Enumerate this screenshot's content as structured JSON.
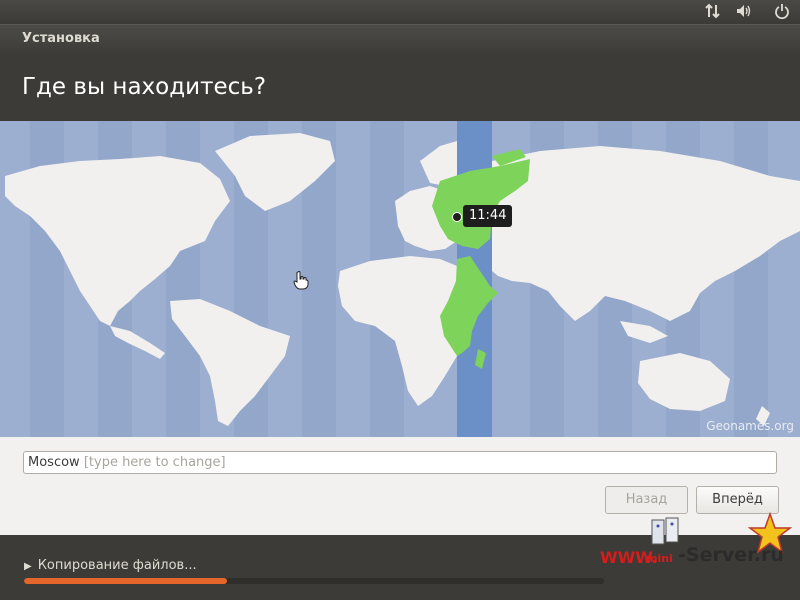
{
  "window": {
    "title": "Установка"
  },
  "page": {
    "title": "Где вы находитесь?"
  },
  "map": {
    "credit": "Geonames.org",
    "selected_city_time": "11:44"
  },
  "location": {
    "value": "Moscow",
    "hint": "[type here to change]"
  },
  "buttons": {
    "back": "Назад",
    "next": "Вперёд"
  },
  "progress": {
    "label": "Копирование файлов...",
    "fraction": 0.35
  },
  "watermark": {
    "left": "WWW.",
    "middle": "mini",
    "right": "-Server.ru"
  },
  "colors": {
    "accent": "#e4662a",
    "ocean": "#9cafd0",
    "land": "#f2f0ee",
    "timezone_band": "#6b8fc7",
    "timezone_land": "#7ed35a"
  },
  "icons": [
    "network-icon",
    "volume-icon",
    "power-icon",
    "pointer-hand-icon"
  ]
}
